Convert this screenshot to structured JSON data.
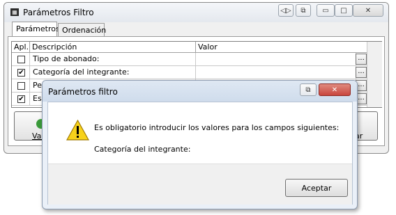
{
  "main_window": {
    "title": "Parámetros Filtro",
    "title_buttons": [
      "◁▷",
      "⧉",
      "▭",
      "□",
      "✕"
    ],
    "tabs": [
      {
        "label": "Parámetros",
        "active": true
      },
      {
        "label": "Ordenación",
        "active": false
      }
    ],
    "table": {
      "headers": [
        "Apl.",
        "Descripción",
        "Valor"
      ],
      "rows": [
        {
          "checked": false,
          "description": "Tipo de abonado:",
          "value": ""
        },
        {
          "checked": true,
          "description": "Categoría del integrante:",
          "value": ""
        },
        {
          "checked": false,
          "description": "Pe...",
          "value": ""
        },
        {
          "checked": true,
          "description": "Es...",
          "value": ""
        }
      ],
      "ellipsis_label": "..."
    },
    "bottom_buttons": {
      "left_label": "Val",
      "right_label": "ar"
    }
  },
  "dialog": {
    "title": "Parámetros filtro",
    "message_line1": "Es obligatorio introducir los valores para los campos siguientes:",
    "message_line2": "Categoría del integrante:",
    "accept_label": "Aceptar",
    "title_button": "⧉",
    "close_button": "✕"
  },
  "colors": {
    "close_red": "#c9463d",
    "warning_yellow": "#f7d21b"
  }
}
